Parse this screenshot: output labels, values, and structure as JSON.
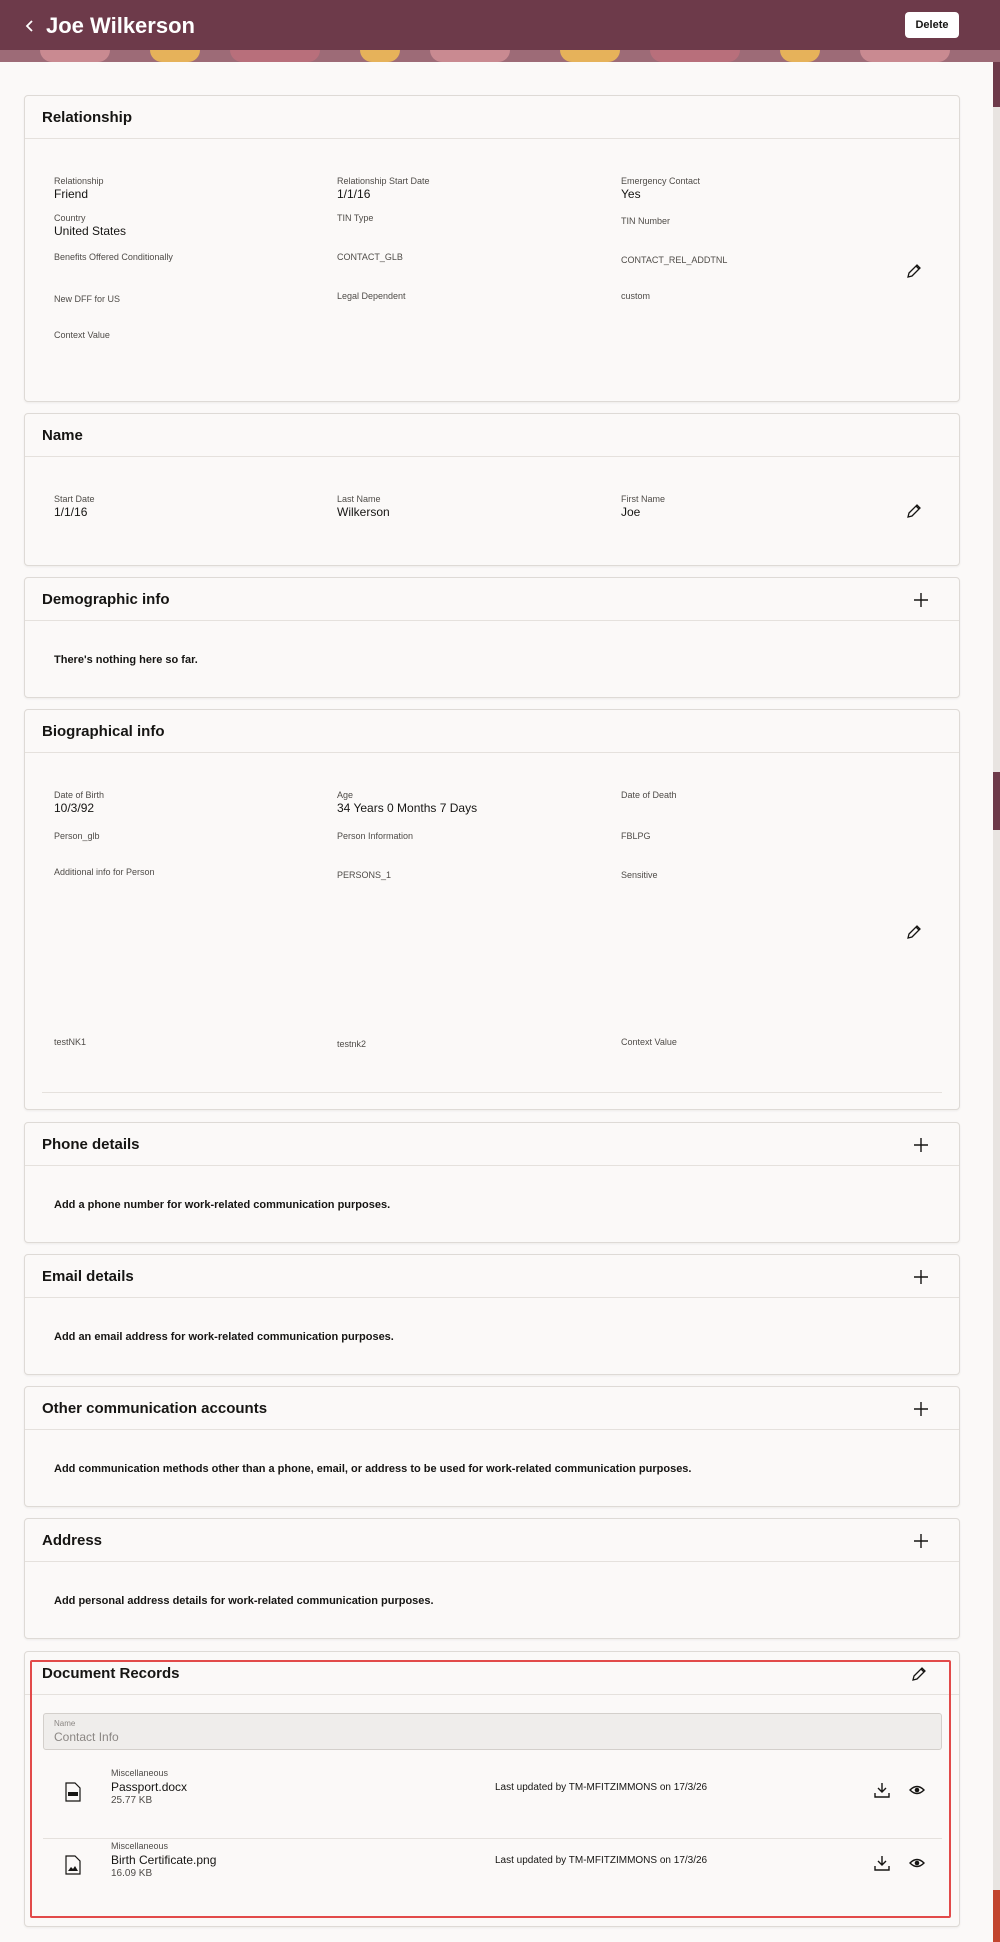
{
  "header": {
    "title": "Joe Wilkerson",
    "delete_label": "Delete",
    "back_icon": "chevron-left-icon",
    "color": "#6d3a4a"
  },
  "relationship": {
    "title": "Relationship",
    "edit_icon": "pencil-icon",
    "fields": [
      {
        "label": "Relationship",
        "value": "Friend"
      },
      {
        "label": "Relationship Start Date",
        "value": "1/1/16"
      },
      {
        "label": "Emergency Contact",
        "value": "Yes"
      },
      {
        "label": "Country",
        "value": "United States"
      },
      {
        "label": "TIN Type",
        "value": ""
      },
      {
        "label": "TIN Number",
        "value": ""
      },
      {
        "label": "Benefits Offered Conditionally",
        "value": ""
      },
      {
        "label": "CONTACT_GLB",
        "value": ""
      },
      {
        "label": "CONTACT_REL_ADDTNL",
        "value": ""
      },
      {
        "label": "New DFF for US",
        "value": ""
      },
      {
        "label": "Legal Dependent",
        "value": ""
      },
      {
        "label": "custom",
        "value": ""
      },
      {
        "label": "Context Value",
        "value": ""
      }
    ]
  },
  "name": {
    "title": "Name",
    "edit_icon": "pencil-icon",
    "fields": [
      {
        "label": "Start Date",
        "value": "1/1/16"
      },
      {
        "label": "Last Name",
        "value": "Wilkerson"
      },
      {
        "label": "First Name",
        "value": "Joe"
      }
    ]
  },
  "demographic": {
    "title": "Demographic info",
    "empty_text": "There's nothing here so far.",
    "add_icon": "plus-icon"
  },
  "biographical": {
    "title": "Biographical info",
    "edit_icon": "pencil-icon",
    "fields": [
      {
        "label": "Date of Birth",
        "value": "10/3/92"
      },
      {
        "label": "Age",
        "value": "34 Years 0 Months 7 Days"
      },
      {
        "label": "Date of Death",
        "value": ""
      },
      {
        "label": "Person_glb",
        "value": ""
      },
      {
        "label": "Person Information",
        "value": ""
      },
      {
        "label": "FBLPG",
        "value": ""
      },
      {
        "label": "Additional info for Person",
        "value": ""
      },
      {
        "label": "PERSONS_1",
        "value": ""
      },
      {
        "label": "Sensitive",
        "value": ""
      },
      {
        "label": "testNK1",
        "value": ""
      },
      {
        "label": "testnk2",
        "value": ""
      },
      {
        "label": "Context Value",
        "value": ""
      }
    ]
  },
  "phone": {
    "title": "Phone details",
    "empty_text": "Add a phone number for work-related communication purposes.",
    "add_icon": "plus-icon"
  },
  "email": {
    "title": "Email details",
    "empty_text": "Add an email address for work-related communication purposes.",
    "add_icon": "plus-icon"
  },
  "other_comm": {
    "title": "Other communication accounts",
    "empty_text": "Add communication methods other than a phone, email, or address to be used for work-related communication purposes.",
    "add_icon": "plus-icon"
  },
  "address": {
    "title": "Address",
    "empty_text": "Add personal address details for work-related communication purposes.",
    "add_icon": "plus-icon"
  },
  "documents": {
    "title": "Document Records",
    "edit_icon": "pencil-icon",
    "name_label": "Name",
    "name_value": "Contact Info",
    "items": [
      {
        "category": "Miscellaneous",
        "file_name": "Passport.docx",
        "size": "25.77 KB",
        "updated": "Last updated by TM-MFITZIMMONS on 17/3/26",
        "icon": "doc-file-icon"
      },
      {
        "category": "Miscellaneous",
        "file_name": "Birth Certificate.png",
        "size": "16.09 KB",
        "updated": "Last updated by TM-MFITZIMMONS on 17/3/26",
        "icon": "image-file-icon"
      }
    ],
    "highlight_color": "#e24a4a"
  }
}
